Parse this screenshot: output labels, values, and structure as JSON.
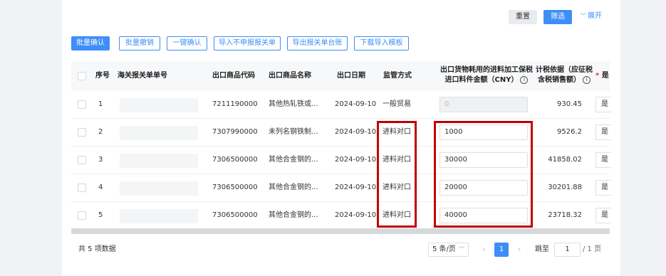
{
  "filters": {
    "reset_label": "重置",
    "filter_label": "筛选",
    "expand_label": "展开"
  },
  "toolbar": {
    "batch_confirm": "批量确认",
    "batch_revoke": "批量撤销",
    "one_click_confirm": "一键确认",
    "import_no_declare": "导入不申报报关单",
    "export_ledger": "导出报关单台账",
    "download_template": "下载导入模板"
  },
  "table": {
    "headers": {
      "seq": "序号",
      "customs_no": "海关报关单单号",
      "product_code": "出口商品代码",
      "product_name": "出口商品名称",
      "export_date": "出口日期",
      "supervision": "监管方式",
      "import_amount_line1": "出口货物耗用的进料加工保税",
      "import_amount_line2": "进口料件金额（CNY）",
      "tax_basis_line1": "计税依据（应征税",
      "tax_basis_line2": "含税销售额）",
      "last_col": "是"
    },
    "rows": [
      {
        "seq": "1",
        "product_code": "7211190000",
        "product_name": "其他热轧铁或...",
        "export_date": "2024-09-10",
        "supervision": "一般贸易",
        "import_amount": "0",
        "import_amount_disabled": true,
        "tax_basis": "930.45",
        "select": "是"
      },
      {
        "seq": "2",
        "product_code": "7307990000",
        "product_name": "未列名钢铁制...",
        "export_date": "2024-09-10",
        "supervision": "进料对口",
        "import_amount": "1000",
        "import_amount_disabled": false,
        "tax_basis": "9526.2",
        "select": "是"
      },
      {
        "seq": "3",
        "product_code": "7306500000",
        "product_name": "其他合金钢的...",
        "export_date": "2024-09-10",
        "supervision": "进料对口",
        "import_amount": "30000",
        "import_amount_disabled": false,
        "tax_basis": "41858.02",
        "select": "是"
      },
      {
        "seq": "4",
        "product_code": "7306500000",
        "product_name": "其他合金钢的...",
        "export_date": "2024-09-10",
        "supervision": "进料对口",
        "import_amount": "20000",
        "import_amount_disabled": false,
        "tax_basis": "30201.88",
        "select": "是"
      },
      {
        "seq": "5",
        "product_code": "7306500000",
        "product_name": "其他合金钢的...",
        "export_date": "2024-09-10",
        "supervision": "进料对口",
        "import_amount": "40000",
        "import_amount_disabled": false,
        "tax_basis": "23718.32",
        "select": "是"
      }
    ]
  },
  "footer": {
    "total_text": "共 5 项数据",
    "page_size": "5 条/页",
    "current_page": "1",
    "jump_label": "跳至",
    "jump_value": "1",
    "total_pages": "/ 1 页"
  },
  "colors": {
    "primary": "#3e8ef7",
    "highlight_box": "#c00000",
    "required_star": "#e53935"
  }
}
